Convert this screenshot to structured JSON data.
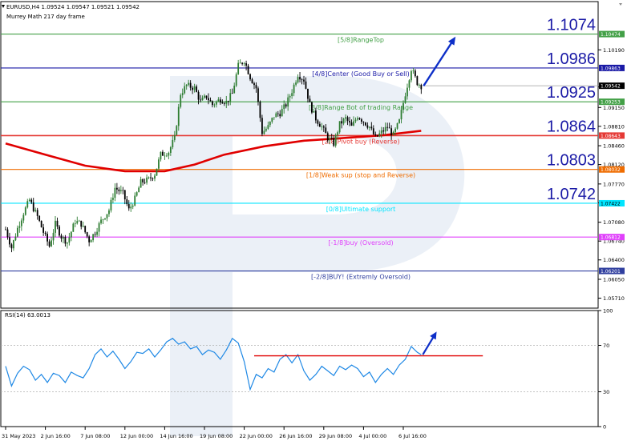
{
  "header": {
    "symbol_line": "EURUSD,H4  1.09524 1.09547 1.09521 1.09542",
    "indicator_line": "Murrey Math 217 day frame"
  },
  "rsi_label": "RSI(14) 63.0013",
  "chart_data": [
    {
      "type": "candlestick",
      "title": "EURUSD,H4",
      "ylim": [
        1.0553,
        1.1106
      ],
      "x_tick_labels": [
        "31 May 2023",
        "2 Jun 16:00",
        "7 Jun 08:00",
        "12 Jun 00:00",
        "14 Jun 16:00",
        "19 Jun 08:00",
        "22 Jun 00:00",
        "26 Jun 16:00",
        "29 Jun 08:00",
        "4 Jul 00:00",
        "6 Jul 16:00"
      ],
      "y_tick_labels": [
        "1.10190",
        "1.09520",
        "1.09150",
        "1.08810",
        "1.08460",
        "1.08120",
        "1.07770",
        "1.07430",
        "1.07080",
        "1.06740",
        "1.06400",
        "1.06050",
        "1.05710"
      ],
      "y_tick_values": [
        1.1019,
        1.0952,
        1.0915,
        1.0881,
        1.0846,
        1.0812,
        1.0777,
        1.0743,
        1.0708,
        1.0674,
        1.064,
        1.0605,
        1.0571
      ],
      "price_line": {
        "value": 1.09542,
        "label": "1.09542"
      },
      "close_path": [
        {
          "t": 0,
          "v": 1.0695
        },
        {
          "t": 3,
          "v": 1.0662
        },
        {
          "t": 6,
          "v": 1.0697
        },
        {
          "t": 9,
          "v": 1.0725
        },
        {
          "t": 12,
          "v": 1.0748
        },
        {
          "t": 16,
          "v": 1.0718
        },
        {
          "t": 19,
          "v": 1.069
        },
        {
          "t": 22,
          "v": 1.0665
        },
        {
          "t": 25,
          "v": 1.0705
        },
        {
          "t": 28,
          "v": 1.0682
        },
        {
          "t": 31,
          "v": 1.0672
        },
        {
          "t": 35,
          "v": 1.071
        },
        {
          "t": 38,
          "v": 1.0705
        },
        {
          "t": 42,
          "v": 1.0675
        },
        {
          "t": 45,
          "v": 1.069
        },
        {
          "t": 48,
          "v": 1.071
        },
        {
          "t": 52,
          "v": 1.073
        },
        {
          "t": 55,
          "v": 1.077
        },
        {
          "t": 59,
          "v": 1.076
        },
        {
          "t": 62,
          "v": 1.073
        },
        {
          "t": 65,
          "v": 1.075
        },
        {
          "t": 68,
          "v": 1.078
        },
        {
          "t": 72,
          "v": 1.0785
        },
        {
          "t": 75,
          "v": 1.0795
        },
        {
          "t": 78,
          "v": 1.083
        },
        {
          "t": 82,
          "v": 1.0835
        },
        {
          "t": 85,
          "v": 1.086
        },
        {
          "t": 88,
          "v": 1.094
        },
        {
          "t": 91,
          "v": 1.0955
        },
        {
          "t": 95,
          "v": 1.095
        },
        {
          "t": 98,
          "v": 1.0925
        },
        {
          "t": 101,
          "v": 1.0935
        },
        {
          "t": 104,
          "v": 1.092
        },
        {
          "t": 108,
          "v": 1.093
        },
        {
          "t": 111,
          "v": 1.0925
        },
        {
          "t": 114,
          "v": 1.094
        },
        {
          "t": 117,
          "v": 1.099
        },
        {
          "t": 120,
          "v": 1.1
        },
        {
          "t": 123,
          "v": 1.097
        },
        {
          "t": 126,
          "v": 1.095
        },
        {
          "t": 129,
          "v": 1.087
        },
        {
          "t": 132,
          "v": 1.088
        },
        {
          "t": 135,
          "v": 1.09
        },
        {
          "t": 138,
          "v": 1.0905
        },
        {
          "t": 141,
          "v": 1.092
        },
        {
          "t": 144,
          "v": 1.0945
        },
        {
          "t": 147,
          "v": 1.0975
        },
        {
          "t": 150,
          "v": 1.0965
        },
        {
          "t": 153,
          "v": 1.092
        },
        {
          "t": 156,
          "v": 1.0895
        },
        {
          "t": 159,
          "v": 1.088
        },
        {
          "t": 162,
          "v": 1.086
        },
        {
          "t": 165,
          "v": 1.085
        },
        {
          "t": 168,
          "v": 1.0885
        },
        {
          "t": 171,
          "v": 1.0895
        },
        {
          "t": 174,
          "v": 1.088
        },
        {
          "t": 177,
          "v": 1.09
        },
        {
          "t": 180,
          "v": 1.089
        },
        {
          "t": 183,
          "v": 1.088
        },
        {
          "t": 186,
          "v": 1.086
        },
        {
          "t": 189,
          "v": 1.087
        },
        {
          "t": 192,
          "v": 1.088
        },
        {
          "t": 195,
          "v": 1.0865
        },
        {
          "t": 198,
          "v": 1.089
        },
        {
          "t": 201,
          "v": 1.094
        },
        {
          "t": 204,
          "v": 1.0985
        },
        {
          "t": 207,
          "v": 1.096
        },
        {
          "t": 209,
          "v": 1.0954
        }
      ],
      "moving_average": [
        {
          "t": 0,
          "v": 1.085
        },
        {
          "t": 20,
          "v": 1.083
        },
        {
          "t": 40,
          "v": 1.081
        },
        {
          "t": 60,
          "v": 1.08
        },
        {
          "t": 80,
          "v": 1.08
        },
        {
          "t": 95,
          "v": 1.0812
        },
        {
          "t": 110,
          "v": 1.083
        },
        {
          "t": 130,
          "v": 1.0845
        },
        {
          "t": 150,
          "v": 1.0855
        },
        {
          "t": 170,
          "v": 1.086
        },
        {
          "t": 190,
          "v": 1.0865
        },
        {
          "t": 209,
          "v": 1.0873
        }
      ],
      "murrey_levels": [
        {
          "value": 1.10474,
          "axis_label": "1.10474",
          "big_label": "1.1074",
          "text": "[5/8]RangeTop",
          "color": "#43a047"
        },
        {
          "value": 1.09863,
          "axis_label": "1.09863",
          "big_label": "1.0986",
          "text": "[4/8]Center (Good Buy or Sell)",
          "color": "#1a1aa6"
        },
        {
          "value": 1.09253,
          "axis_label": "1.09253",
          "big_label": "1.0925",
          "text": "[3/8]Range Bot of trading Range",
          "color": "#43a047"
        },
        {
          "value": 1.08643,
          "axis_label": "1.08643",
          "big_label": "1.0864",
          "text": "[2/8]Pivot buy (Reverse)",
          "color": "#e53935"
        },
        {
          "value": 1.08032,
          "axis_label": "1.08032",
          "big_label": "1.0803",
          "text": "[1/8]Weak sup (stop and Reverse)",
          "color": "#ef6c00"
        },
        {
          "value": 1.07422,
          "axis_label": "1.07422",
          "big_label": "1.0742",
          "text": "[0/8]Ultimate support",
          "color": "#00e5ff"
        },
        {
          "value": 1.06812,
          "axis_label": "1.06812",
          "big_label": "",
          "text": "[-1/8]buy (Oversold)",
          "color": "#e040fb"
        },
        {
          "value": 1.06201,
          "axis_label": "1.06201",
          "big_label": "",
          "text": "[-2/8]BUY! (Extremly Oversold)",
          "color": "#303f9f"
        }
      ],
      "colors": {
        "bull": "#2e7d32",
        "bear": "#000000",
        "ma": "#e00000",
        "arrow": "#0d2fc8",
        "watermark": "#dbe4f0"
      }
    },
    {
      "type": "line",
      "title": "RSI(14) 63.0013",
      "ylim": [
        0,
        100
      ],
      "y_tick_labels": [
        "100",
        "70",
        "30",
        "0"
      ],
      "y_tick_values": [
        100,
        70,
        30,
        0
      ],
      "levels": [
        70,
        30
      ],
      "support_line": {
        "value": 61,
        "from_t": 125,
        "to_t": 240
      },
      "path": [
        {
          "t": 0,
          "v": 52
        },
        {
          "t": 3,
          "v": 35
        },
        {
          "t": 6,
          "v": 46
        },
        {
          "t": 9,
          "v": 52
        },
        {
          "t": 12,
          "v": 49
        },
        {
          "t": 15,
          "v": 40
        },
        {
          "t": 18,
          "v": 45
        },
        {
          "t": 21,
          "v": 38
        },
        {
          "t": 24,
          "v": 46
        },
        {
          "t": 27,
          "v": 44
        },
        {
          "t": 30,
          "v": 38
        },
        {
          "t": 33,
          "v": 47
        },
        {
          "t": 36,
          "v": 44
        },
        {
          "t": 39,
          "v": 42
        },
        {
          "t": 42,
          "v": 50
        },
        {
          "t": 45,
          "v": 62
        },
        {
          "t": 48,
          "v": 67
        },
        {
          "t": 51,
          "v": 60
        },
        {
          "t": 54,
          "v": 65
        },
        {
          "t": 57,
          "v": 58
        },
        {
          "t": 60,
          "v": 50
        },
        {
          "t": 63,
          "v": 56
        },
        {
          "t": 66,
          "v": 64
        },
        {
          "t": 69,
          "v": 63
        },
        {
          "t": 72,
          "v": 67
        },
        {
          "t": 75,
          "v": 60
        },
        {
          "t": 78,
          "v": 66
        },
        {
          "t": 81,
          "v": 73
        },
        {
          "t": 84,
          "v": 76
        },
        {
          "t": 87,
          "v": 71
        },
        {
          "t": 90,
          "v": 73
        },
        {
          "t": 93,
          "v": 67
        },
        {
          "t": 96,
          "v": 69
        },
        {
          "t": 99,
          "v": 62
        },
        {
          "t": 102,
          "v": 66
        },
        {
          "t": 105,
          "v": 64
        },
        {
          "t": 108,
          "v": 58
        },
        {
          "t": 111,
          "v": 66
        },
        {
          "t": 114,
          "v": 76
        },
        {
          "t": 117,
          "v": 72
        },
        {
          "t": 120,
          "v": 56
        },
        {
          "t": 123,
          "v": 32
        },
        {
          "t": 126,
          "v": 45
        },
        {
          "t": 129,
          "v": 42
        },
        {
          "t": 132,
          "v": 50
        },
        {
          "t": 135,
          "v": 47
        },
        {
          "t": 138,
          "v": 58
        },
        {
          "t": 141,
          "v": 62
        },
        {
          "t": 144,
          "v": 55
        },
        {
          "t": 147,
          "v": 62
        },
        {
          "t": 150,
          "v": 48
        },
        {
          "t": 153,
          "v": 40
        },
        {
          "t": 156,
          "v": 45
        },
        {
          "t": 159,
          "v": 52
        },
        {
          "t": 162,
          "v": 48
        },
        {
          "t": 165,
          "v": 44
        },
        {
          "t": 168,
          "v": 52
        },
        {
          "t": 171,
          "v": 49
        },
        {
          "t": 174,
          "v": 53
        },
        {
          "t": 177,
          "v": 50
        },
        {
          "t": 180,
          "v": 43
        },
        {
          "t": 183,
          "v": 47
        },
        {
          "t": 186,
          "v": 38
        },
        {
          "t": 189,
          "v": 45
        },
        {
          "t": 192,
          "v": 50
        },
        {
          "t": 195,
          "v": 45
        },
        {
          "t": 198,
          "v": 53
        },
        {
          "t": 201,
          "v": 58
        },
        {
          "t": 204,
          "v": 69
        },
        {
          "t": 207,
          "v": 64
        },
        {
          "t": 209,
          "v": 62
        }
      ]
    }
  ]
}
